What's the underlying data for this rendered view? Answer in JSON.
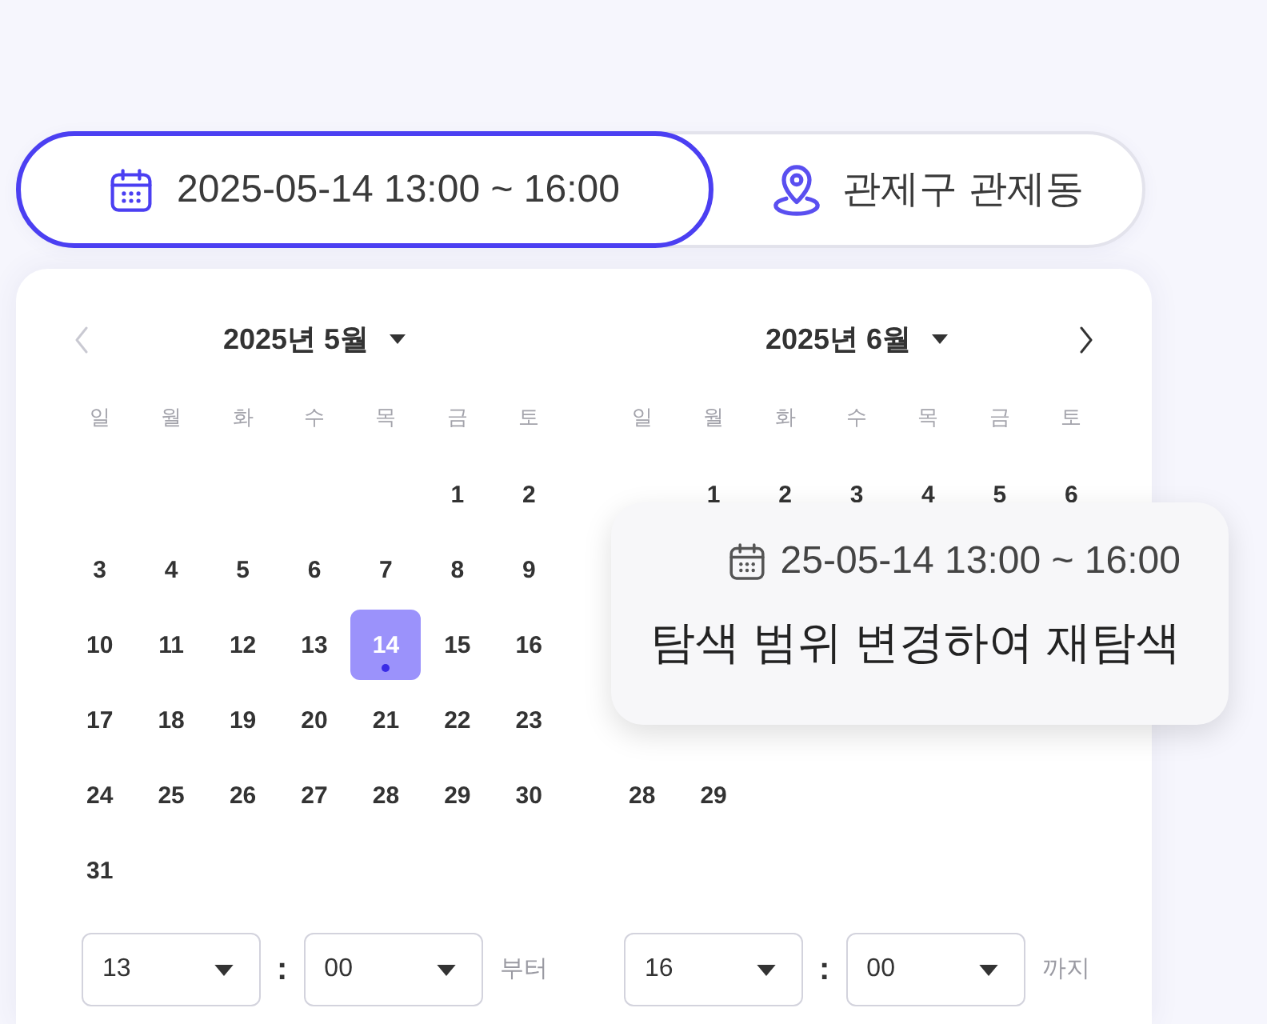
{
  "tabs": [
    {
      "kind": "date",
      "label": "2025-05-14 13:00 ~ 16:00",
      "selected": true
    },
    {
      "kind": "location",
      "label": "관제구 관제동",
      "selected": false
    }
  ],
  "calendars": [
    {
      "title": "2025년 5월",
      "nav": {
        "kind": "prev",
        "disabled": true
      },
      "weekdays": [
        "일",
        "월",
        "화",
        "수",
        "목",
        "금",
        "토"
      ],
      "weeks": [
        [
          {
            "kind": "blank"
          },
          {
            "kind": "blank"
          },
          {
            "kind": "blank"
          },
          {
            "kind": "blank"
          },
          {
            "kind": "blank"
          },
          {
            "kind": "day",
            "label": "1",
            "selected": false,
            "marked": false
          },
          {
            "kind": "day",
            "label": "2",
            "selected": false,
            "marked": false
          }
        ],
        [
          {
            "kind": "day",
            "label": "3",
            "selected": false,
            "marked": false
          },
          {
            "kind": "day",
            "label": "4",
            "selected": false,
            "marked": false
          },
          {
            "kind": "day",
            "label": "5",
            "selected": false,
            "marked": false
          },
          {
            "kind": "day",
            "label": "6",
            "selected": false,
            "marked": false
          },
          {
            "kind": "day",
            "label": "7",
            "selected": false,
            "marked": false
          },
          {
            "kind": "day",
            "label": "8",
            "selected": false,
            "marked": false
          },
          {
            "kind": "day",
            "label": "9",
            "selected": false,
            "marked": false
          }
        ],
        [
          {
            "kind": "day",
            "label": "10",
            "selected": false,
            "marked": false
          },
          {
            "kind": "day",
            "label": "11",
            "selected": false,
            "marked": false
          },
          {
            "kind": "day",
            "label": "12",
            "selected": false,
            "marked": false
          },
          {
            "kind": "day",
            "label": "13",
            "selected": false,
            "marked": false
          },
          {
            "kind": "day",
            "label": "14",
            "selected": true,
            "marked": true
          },
          {
            "kind": "day",
            "label": "15",
            "selected": false,
            "marked": false
          },
          {
            "kind": "day",
            "label": "16",
            "selected": false,
            "marked": false
          }
        ],
        [
          {
            "kind": "day",
            "label": "17",
            "selected": false,
            "marked": false
          },
          {
            "kind": "day",
            "label": "18",
            "selected": false,
            "marked": false
          },
          {
            "kind": "day",
            "label": "19",
            "selected": false,
            "marked": false
          },
          {
            "kind": "day",
            "label": "20",
            "selected": false,
            "marked": false
          },
          {
            "kind": "day",
            "label": "21",
            "selected": false,
            "marked": false
          },
          {
            "kind": "day",
            "label": "22",
            "selected": false,
            "marked": false
          },
          {
            "kind": "day",
            "label": "23",
            "selected": false,
            "marked": false
          }
        ],
        [
          {
            "kind": "day",
            "label": "24",
            "selected": false,
            "marked": false
          },
          {
            "kind": "day",
            "label": "25",
            "selected": false,
            "marked": false
          },
          {
            "kind": "day",
            "label": "26",
            "selected": false,
            "marked": false
          },
          {
            "kind": "day",
            "label": "27",
            "selected": false,
            "marked": false
          },
          {
            "kind": "day",
            "label": "28",
            "selected": false,
            "marked": false
          },
          {
            "kind": "day",
            "label": "29",
            "selected": false,
            "marked": false
          },
          {
            "kind": "day",
            "label": "30",
            "selected": false,
            "marked": false
          }
        ],
        [
          {
            "kind": "day",
            "label": "31",
            "selected": false,
            "marked": false
          },
          {
            "kind": "blank"
          },
          {
            "kind": "blank"
          },
          {
            "kind": "blank"
          },
          {
            "kind": "blank"
          },
          {
            "kind": "blank"
          },
          {
            "kind": "blank"
          }
        ]
      ],
      "time": {
        "hour": "13",
        "separator": ":",
        "minute": "00",
        "suffix": "부터"
      }
    },
    {
      "title": "2025년 6월",
      "nav": {
        "kind": "next",
        "disabled": false
      },
      "weekdays": [
        "일",
        "월",
        "화",
        "수",
        "목",
        "금",
        "토"
      ],
      "weeks": [
        [
          {
            "kind": "blank"
          },
          {
            "kind": "day",
            "label": "1",
            "selected": false,
            "marked": false
          },
          {
            "kind": "day",
            "label": "2",
            "selected": false,
            "marked": false
          },
          {
            "kind": "day",
            "label": "3",
            "selected": false,
            "marked": false
          },
          {
            "kind": "day",
            "label": "4",
            "selected": false,
            "marked": false
          },
          {
            "kind": "day",
            "label": "5",
            "selected": false,
            "marked": false
          },
          {
            "kind": "day",
            "label": "6",
            "selected": false,
            "marked": false
          }
        ],
        [
          {
            "kind": "blank"
          },
          {
            "kind": "blank"
          },
          {
            "kind": "blank"
          },
          {
            "kind": "blank"
          },
          {
            "kind": "blank"
          },
          {
            "kind": "blank"
          },
          {
            "kind": "blank"
          }
        ],
        [
          {
            "kind": "blank"
          },
          {
            "kind": "blank"
          },
          {
            "kind": "blank"
          },
          {
            "kind": "blank"
          },
          {
            "kind": "blank"
          },
          {
            "kind": "blank"
          },
          {
            "kind": "blank"
          }
        ],
        [
          {
            "kind": "blank"
          },
          {
            "kind": "blank"
          },
          {
            "kind": "blank"
          },
          {
            "kind": "blank"
          },
          {
            "kind": "blank"
          },
          {
            "kind": "blank"
          },
          {
            "kind": "blank"
          }
        ],
        [
          {
            "kind": "day",
            "label": "28",
            "selected": false,
            "marked": false
          },
          {
            "kind": "day",
            "label": "29",
            "selected": false,
            "marked": false
          },
          {
            "kind": "blank"
          },
          {
            "kind": "blank"
          },
          {
            "kind": "blank"
          },
          {
            "kind": "blank"
          },
          {
            "kind": "blank"
          }
        ]
      ],
      "time": {
        "hour": "16",
        "separator": ":",
        "minute": "00",
        "suffix": "까지"
      }
    }
  ],
  "popover": {
    "date": "25-05-14 13:00 ~ 16:00",
    "action": "탐색 범위 변경하여 재탐색"
  }
}
